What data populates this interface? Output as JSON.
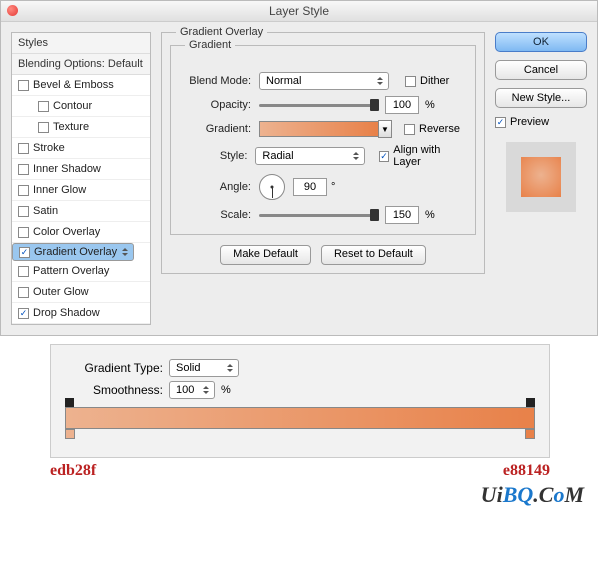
{
  "dialog": {
    "title": "Layer Style",
    "fieldset_label": "Gradient Overlay",
    "inner_label": "Gradient",
    "blendmode_label": "Blend Mode:",
    "blendmode_value": "Normal",
    "dither_label": "Dither",
    "opacity_label": "Opacity:",
    "opacity_value": "100",
    "pct": "%",
    "gradient_label": "Gradient:",
    "reverse_label": "Reverse",
    "style_label": "Style:",
    "style_value": "Radial",
    "align_label": "Align with Layer",
    "angle_label": "Angle:",
    "angle_value": "90",
    "deg": "°",
    "scale_label": "Scale:",
    "scale_value": "150",
    "make_default": "Make Default",
    "reset_default": "Reset to Default"
  },
  "sidebar": {
    "styles": "Styles",
    "blending": "Blending Options: Default",
    "bevel": "Bevel & Emboss",
    "contour": "Contour",
    "texture": "Texture",
    "stroke": "Stroke",
    "inner_shadow": "Inner Shadow",
    "inner_glow": "Inner Glow",
    "satin": "Satin",
    "color_overlay": "Color Overlay",
    "gradient_overlay": "Gradient Overlay",
    "pattern_overlay": "Pattern Overlay",
    "outer_glow": "Outer Glow",
    "drop_shadow": "Drop Shadow"
  },
  "buttons": {
    "ok": "OK",
    "cancel": "Cancel",
    "new_style": "New Style...",
    "preview": "Preview"
  },
  "editor": {
    "gtype_label": "Gradient Type:",
    "gtype_value": "Solid",
    "smooth_label": "Smoothness:",
    "smooth_value": "100",
    "pct": "%",
    "left_color": "edb28f",
    "right_color": "e88149"
  },
  "watermark": {
    "u": "U",
    "i": "i",
    "bq": "BQ",
    "c": "C",
    "o": "o",
    "m": "M",
    "dot1": ".",
    "dot2": "."
  }
}
